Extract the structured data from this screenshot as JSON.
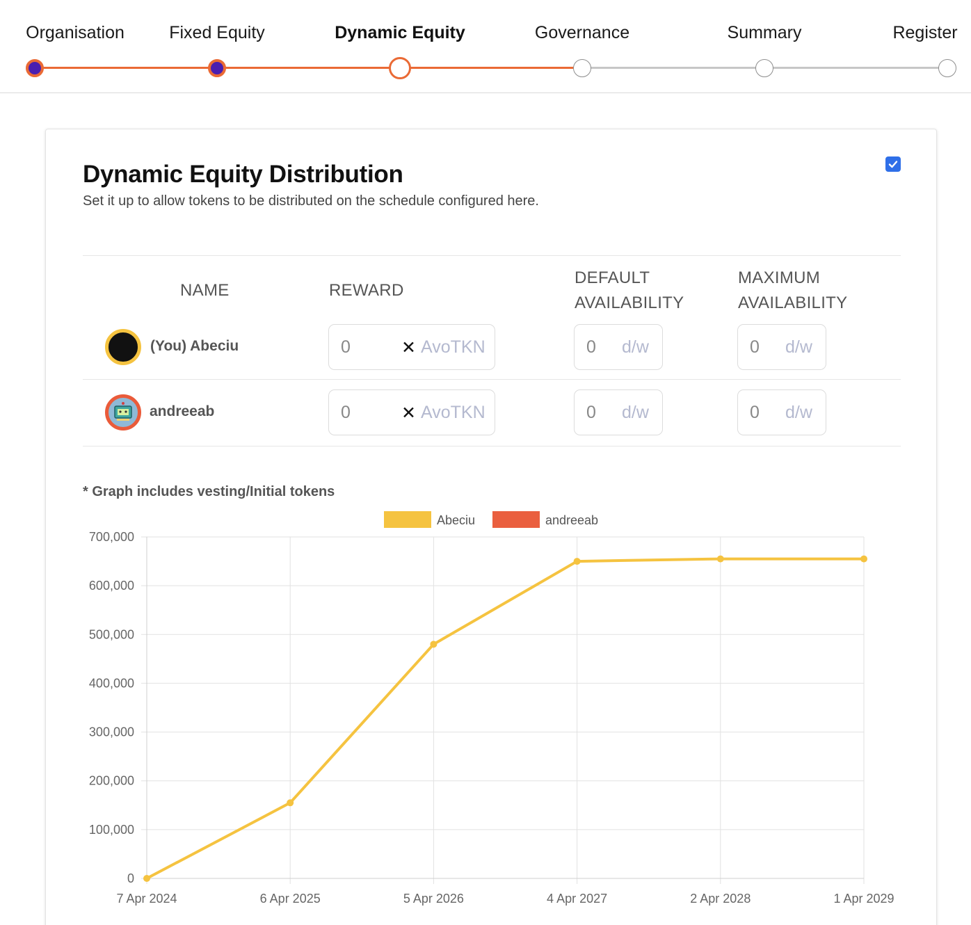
{
  "stepper": {
    "steps": [
      {
        "label": "Organisation",
        "state": "done"
      },
      {
        "label": "Fixed Equity",
        "state": "done"
      },
      {
        "label": "Dynamic Equity",
        "state": "current"
      },
      {
        "label": "Governance",
        "state": "todo"
      },
      {
        "label": "Summary",
        "state": "todo"
      },
      {
        "label": "Register",
        "state": "todo"
      }
    ],
    "colors": {
      "accent": "#ea6a35",
      "done_fill": "#4a1eb0",
      "todo": "#c6c6c6"
    }
  },
  "card": {
    "title": "Dynamic Equity Distribution",
    "subtitle": "Set it up to allow tokens to be distributed on the schedule configured here.",
    "enabled": true
  },
  "table": {
    "headers": {
      "name": "NAME",
      "reward": "REWARD",
      "default_line1": "DEFAULT",
      "default_line2": "AVAILABILITY",
      "max_line1": "MAXIMUM",
      "max_line2": "AVAILABILITY"
    },
    "rows": [
      {
        "name": "(You) Abeciu",
        "avatar": "black-avatar-icon",
        "reward": "0",
        "times": "✕",
        "reward_unit": "AvoTKN",
        "default_value": "0",
        "default_unit": "d/w",
        "max_value": "0",
        "max_unit": "d/w"
      },
      {
        "name": "andreeab",
        "avatar": "robot-avatar-icon",
        "reward": "0",
        "times": "✕",
        "reward_unit": "AvoTKN",
        "default_value": "0",
        "default_unit": "d/w",
        "max_value": "0",
        "max_unit": "d/w"
      }
    ]
  },
  "graph_note": "* Graph includes vesting/Initial tokens",
  "chart_data": {
    "type": "line",
    "categories": [
      "7 Apr 2024",
      "6 Apr 2025",
      "5 Apr 2026",
      "4 Apr 2027",
      "2 Apr 2028",
      "1 Apr 2029"
    ],
    "series": [
      {
        "name": "Abeciu",
        "color": "#f5c340",
        "values": [
          0,
          155000,
          480000,
          650000,
          655000,
          655000
        ]
      },
      {
        "name": "andreeab",
        "color": "#ea5f3f",
        "values": []
      }
    ],
    "y_ticks": [
      "0",
      "100,000",
      "200,000",
      "300,000",
      "400,000",
      "500,000",
      "600,000",
      "700,000"
    ],
    "ylim": [
      0,
      700000
    ],
    "grid": true,
    "legend": "top-center"
  }
}
